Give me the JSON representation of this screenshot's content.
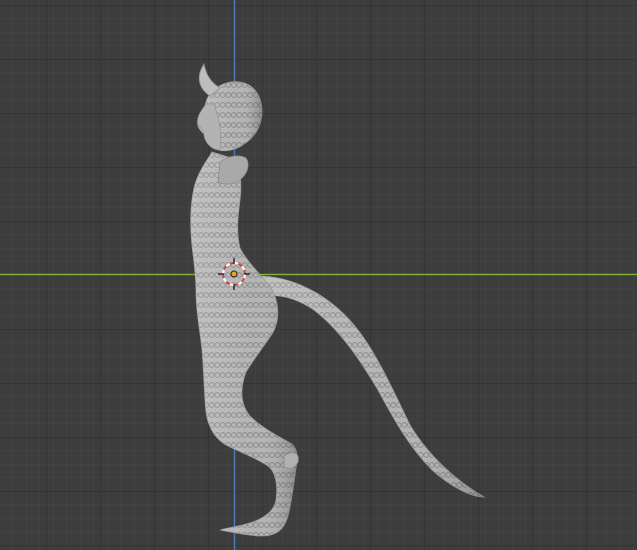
{
  "viewport": {
    "view": "side-orthographic",
    "background_color": "#3d3d3d",
    "grid": "on",
    "grid_minor_color": "#454545",
    "grid_major_color": "#353535",
    "x_axis_color": "#7bb33a",
    "z_axis_color": "#4e7cb8"
  },
  "model": {
    "description_icon": "sculpt-mesh",
    "color": "#b8b8b8"
  },
  "cursor": {
    "icon": "3d-cursor-icon",
    "ring_colors": [
      "#ffffff",
      "#e0403a"
    ]
  },
  "origin": {
    "icon": "object-origin-dot",
    "color": "#f0a020"
  }
}
